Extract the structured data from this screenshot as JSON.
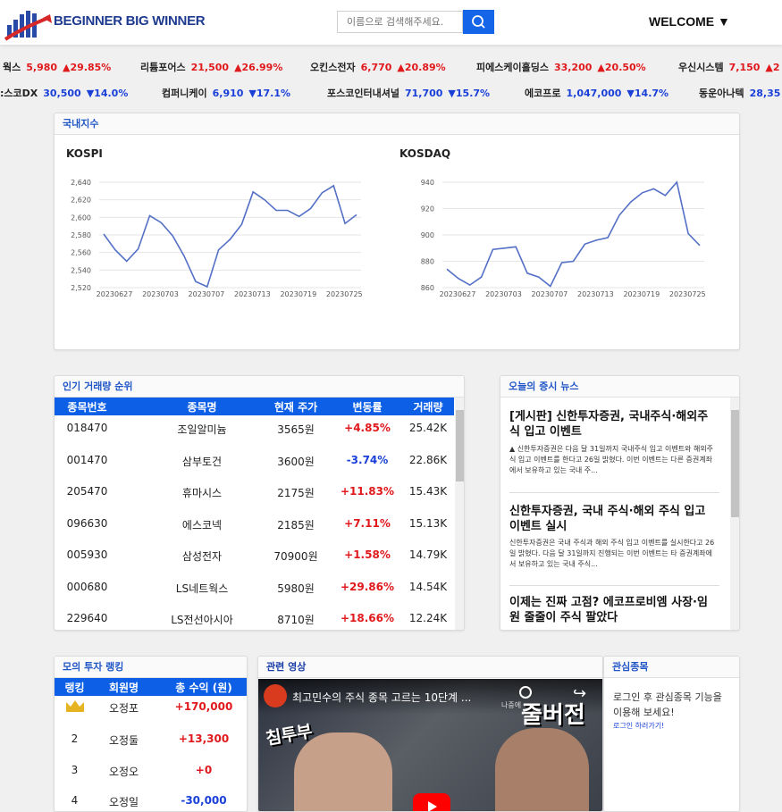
{
  "header": {
    "brand": "BEGINNER BIG WINNER",
    "search_placeholder": "이름으로 검색해주세요.",
    "welcome": "WELCOME ▼"
  },
  "ticker_up": [
    {
      "name": "웍스",
      "price": "5,980",
      "change": "▲29.85%"
    },
    {
      "name": "리튬포어스",
      "price": "21,500",
      "change": "▲26.99%"
    },
    {
      "name": "오킨스전자",
      "price": "6,770",
      "change": "▲20.89%"
    },
    {
      "name": "피에스케이홀딩스",
      "price": "33,200",
      "change": "▲20.50%"
    },
    {
      "name": "우신시스템",
      "price": "7,150",
      "change": "▲2"
    }
  ],
  "ticker_down": [
    {
      "name": ":스코DX",
      "price": "30,500",
      "change": "▼14.0%"
    },
    {
      "name": "컴퍼니케이",
      "price": "6,910",
      "change": "▼17.1%"
    },
    {
      "name": "포스코인터내셔널",
      "price": "71,700",
      "change": "▼15.7%"
    },
    {
      "name": "에코프로",
      "price": "1,047,000",
      "change": "▼14.7%"
    },
    {
      "name": "동운아나텍",
      "price": "28,35",
      "change": ""
    }
  ],
  "index_panel": {
    "title": "국내지수",
    "charts": [
      "KOSPI",
      "KOSDAQ"
    ]
  },
  "chart_data": [
    {
      "type": "line",
      "title": "KOSPI",
      "x_ticks": [
        "20230627",
        "20230703",
        "20230707",
        "20230713",
        "20230719",
        "20230725"
      ],
      "y_ticks": [
        "2,640",
        "2,620",
        "2,600",
        "2,580",
        "2,560",
        "2,540",
        "2,520"
      ],
      "ylim": [
        2520,
        2640
      ],
      "values": [
        2581,
        2563,
        2550,
        2564,
        2602,
        2594,
        2579,
        2556,
        2527,
        2521,
        2563,
        2575,
        2592,
        2629,
        2620,
        2608,
        2608,
        2601,
        2610,
        2628,
        2636,
        2593,
        2603
      ]
    },
    {
      "type": "line",
      "title": "KOSDAQ",
      "x_ticks": [
        "20230627",
        "20230703",
        "20230707",
        "20230713",
        "20230719",
        "20230725"
      ],
      "y_ticks": [
        "940",
        "920",
        "900",
        "880",
        "860"
      ],
      "ylim": [
        860,
        940
      ],
      "values": [
        874,
        867,
        862,
        868,
        889,
        890,
        891,
        871,
        868,
        861,
        879,
        880,
        893,
        896,
        898,
        915,
        925,
        932,
        935,
        930,
        940,
        901,
        892
      ]
    }
  ],
  "volume_panel": {
    "title": "인기 거래량 순위",
    "headers": [
      "종목번호",
      "종목명",
      "현재 주가",
      "변동률",
      "거래량"
    ],
    "rows": [
      {
        "code": "018470",
        "name": "조일알미늄",
        "price": "3565원",
        "change": "+4.85%",
        "volume": "25.42K",
        "dir": "up"
      },
      {
        "code": "001470",
        "name": "삼부토건",
        "price": "3600원",
        "change": "-3.74%",
        "volume": "22.86K",
        "dir": "down"
      },
      {
        "code": "205470",
        "name": "휴마시스",
        "price": "2175원",
        "change": "+11.83%",
        "volume": "15.43K",
        "dir": "up"
      },
      {
        "code": "096630",
        "name": "에스코넥",
        "price": "2185원",
        "change": "+7.11%",
        "volume": "15.13K",
        "dir": "up"
      },
      {
        "code": "005930",
        "name": "삼성전자",
        "price": "70900원",
        "change": "+1.58%",
        "volume": "14.79K",
        "dir": "up"
      },
      {
        "code": "000680",
        "name": "LS네트웍스",
        "price": "5980원",
        "change": "+29.86%",
        "volume": "14.54K",
        "dir": "up"
      },
      {
        "code": "229640",
        "name": "LS전선아시아",
        "price": "8710원",
        "change": "+18.66%",
        "volume": "12.24K",
        "dir": "up"
      }
    ]
  },
  "news_panel": {
    "title": "오늘의 증시 뉴스",
    "items": [
      {
        "title": "[게시판] 신한투자증권, 국내주식·해외주식 입고 이벤트",
        "body": "▲ 신한투자증권은 다음 달 31일까지 국내주식 입고 이벤트와 해외주식 입고 이벤트를 한다고 26일 밝혔다. 이번 이벤트는 다른 증권계좌에서 보유하고 있는 국내 주..."
      },
      {
        "title": "신한투자증권, 국내 주식·해외 주식 입고 이벤트 실시",
        "body": "신한투자증권은 국내 주식과 해외 주식 입고 이벤트를 실시한다고 26일 밝혔다. 다음 달 31일까지 진행되는 이번 이벤트는 타 증권계좌에서 보유하고 있는 국내 주식..."
      },
      {
        "title": "이제는 진짜 고점? 에코프로비엠 사장·임원 줄줄이 주식 팔았다",
        "body": ""
      }
    ]
  },
  "ranking_panel": {
    "title": "모의 투자 랭킹",
    "headers": [
      "랭킹",
      "회원명",
      "총 수익 (원)"
    ],
    "rows": [
      {
        "rank": "",
        "name": "오정포",
        "profit": "+170,000"
      },
      {
        "rank": "2",
        "name": "오정둘",
        "profit": "+13,300"
      },
      {
        "rank": "3",
        "name": "오정오",
        "profit": "+0"
      },
      {
        "rank": "4",
        "name": "오정일",
        "profit": "-30,000"
      }
    ]
  },
  "video_panel": {
    "title": "관련 영상",
    "video_title": "최고민수의 주식 종목 고르는 10단계 ...",
    "channel": "침투부",
    "side_text": "나중에",
    "overlay": "줄버전"
  },
  "watch_panel": {
    "title": "관심종목",
    "message": "로그인 후 관심종목 기능을 이용해 보세요!",
    "link": "로그인 하러가기!"
  },
  "colors": {
    "accent": "#0d5fe6",
    "up": "#e0191d",
    "down": "#1a40d8",
    "chart_line": "#5470c6"
  }
}
